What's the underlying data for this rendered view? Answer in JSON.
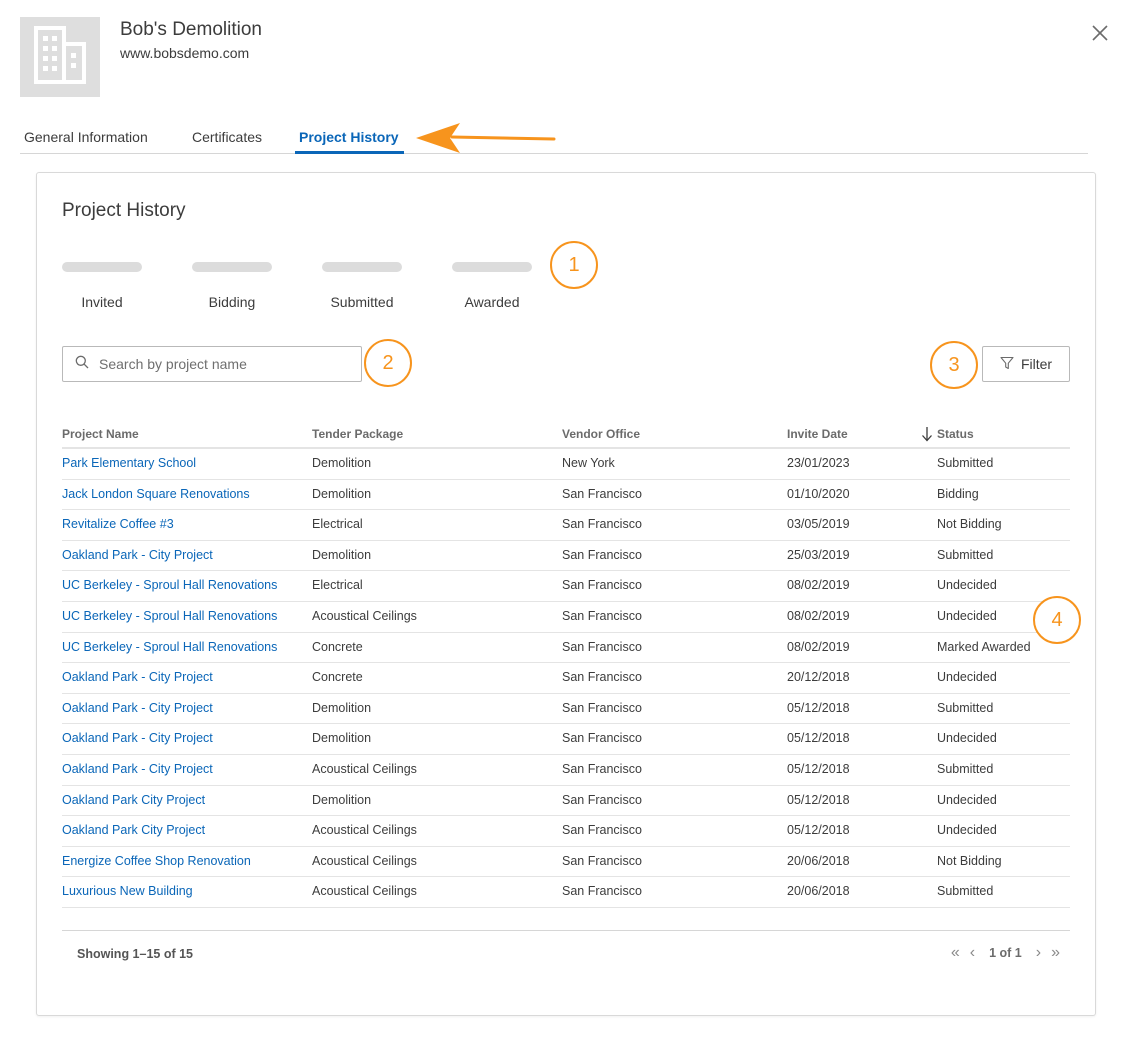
{
  "company": {
    "name": "Bob's Demolition",
    "url": "www.bobsdemo.com"
  },
  "tabs": [
    {
      "label": "General Information"
    },
    {
      "label": "Certificates"
    },
    {
      "label": "Project History"
    }
  ],
  "card": {
    "title": "Project History",
    "stats": [
      {
        "label": "Invited"
      },
      {
        "label": "Bidding"
      },
      {
        "label": "Submitted"
      },
      {
        "label": "Awarded"
      }
    ]
  },
  "search": {
    "placeholder": "Search by project name"
  },
  "filter_label": "Filter",
  "callouts": [
    "1",
    "2",
    "3",
    "4"
  ],
  "columns": [
    "Project Name",
    "Tender Package",
    "Vendor Office",
    "Invite Date",
    "Status"
  ],
  "rows": [
    {
      "project": "Park Elementary School",
      "package": "Demolition",
      "office": "New York",
      "date": "23/01/2023",
      "status": "Submitted"
    },
    {
      "project": "Jack London Square Renovations",
      "package": "Demolition",
      "office": "San Francisco",
      "date": "01/10/2020",
      "status": "Bidding"
    },
    {
      "project": "Revitalize Coffee #3",
      "package": "Electrical",
      "office": "San Francisco",
      "date": "03/05/2019",
      "status": "Not Bidding"
    },
    {
      "project": "Oakland Park - City Project",
      "package": "Demolition",
      "office": "San Francisco",
      "date": "25/03/2019",
      "status": "Submitted"
    },
    {
      "project": "UC Berkeley - Sproul Hall Renovations",
      "package": "Electrical",
      "office": "San Francisco",
      "date": "08/02/2019",
      "status": "Undecided"
    },
    {
      "project": "UC Berkeley - Sproul Hall Renovations",
      "package": "Acoustical Ceilings",
      "office": "San Francisco",
      "date": "08/02/2019",
      "status": "Undecided"
    },
    {
      "project": "UC Berkeley - Sproul Hall Renovations",
      "package": "Concrete",
      "office": "San Francisco",
      "date": "08/02/2019",
      "status": "Marked Awarded"
    },
    {
      "project": "Oakland Park - City Project",
      "package": "Concrete",
      "office": "San Francisco",
      "date": "20/12/2018",
      "status": "Undecided"
    },
    {
      "project": "Oakland Park - City Project",
      "package": "Demolition",
      "office": "San Francisco",
      "date": "05/12/2018",
      "status": "Submitted"
    },
    {
      "project": "Oakland Park - City Project",
      "package": "Demolition",
      "office": "San Francisco",
      "date": "05/12/2018",
      "status": "Undecided"
    },
    {
      "project": "Oakland Park - City Project",
      "package": "Acoustical Ceilings",
      "office": "San Francisco",
      "date": "05/12/2018",
      "status": "Submitted"
    },
    {
      "project": "Oakland Park City Project",
      "package": "Demolition",
      "office": "San Francisco",
      "date": "05/12/2018",
      "status": "Undecided"
    },
    {
      "project": "Oakland Park City Project",
      "package": "Acoustical Ceilings",
      "office": "San Francisco",
      "date": "05/12/2018",
      "status": "Undecided"
    },
    {
      "project": "Energize Coffee Shop Renovation",
      "package": "Acoustical Ceilings",
      "office": "San Francisco",
      "date": "20/06/2018",
      "status": "Not Bidding"
    },
    {
      "project": "Luxurious New Building",
      "package": "Acoustical Ceilings",
      "office": "San Francisco",
      "date": "20/06/2018",
      "status": "Submitted"
    }
  ],
  "footer": {
    "showing": "Showing 1–15 of 15",
    "page_info": "1 of 1"
  },
  "colors": {
    "accent": "#0a66b8",
    "callout": "#f7941d"
  },
  "icons": [
    "building-icon",
    "close-icon",
    "search-icon",
    "filter-icon",
    "sort-down-icon",
    "first-page-icon",
    "prev-page-icon",
    "next-page-icon",
    "last-page-icon"
  ]
}
